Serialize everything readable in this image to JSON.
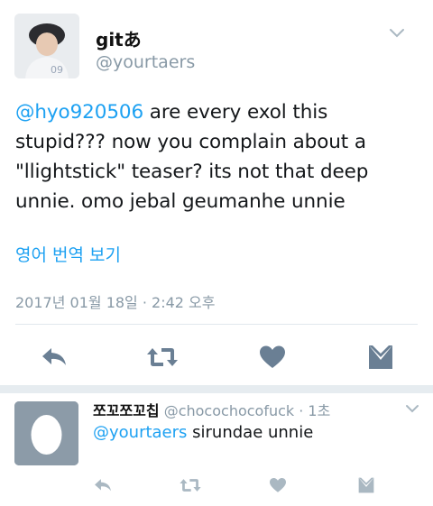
{
  "main_tweet": {
    "display_name": "gitあ",
    "handle": "@yourtaers",
    "mention": "@hyo920506",
    "text": " are every exol this stupid??? now you complain about a \"llightstick\" teaser? its not that deep unnie. omo jebal geumanhe unnie",
    "translate_label": "영어 번역 보기",
    "timestamp": "2017년 01월 18일 · 2:42 오후",
    "avatar_icon": "user-photo-avatar"
  },
  "actions": {
    "reply_icon": "reply-arrow-icon",
    "retweet_icon": "retweet-icon",
    "like_icon": "heart-icon",
    "dm_icon": "envelope-icon"
  },
  "reply_tweet": {
    "display_name": "쪼꼬쪼꼬칩",
    "handle": "@chocochocofuck",
    "time": " · 1초",
    "mention": "@yourtaers",
    "text": " sirundae unnie",
    "avatar_icon": "default-egg-avatar"
  },
  "colors": {
    "accent": "#1da1f2",
    "icon": "#6a7f94",
    "muted": "#8899a6"
  }
}
